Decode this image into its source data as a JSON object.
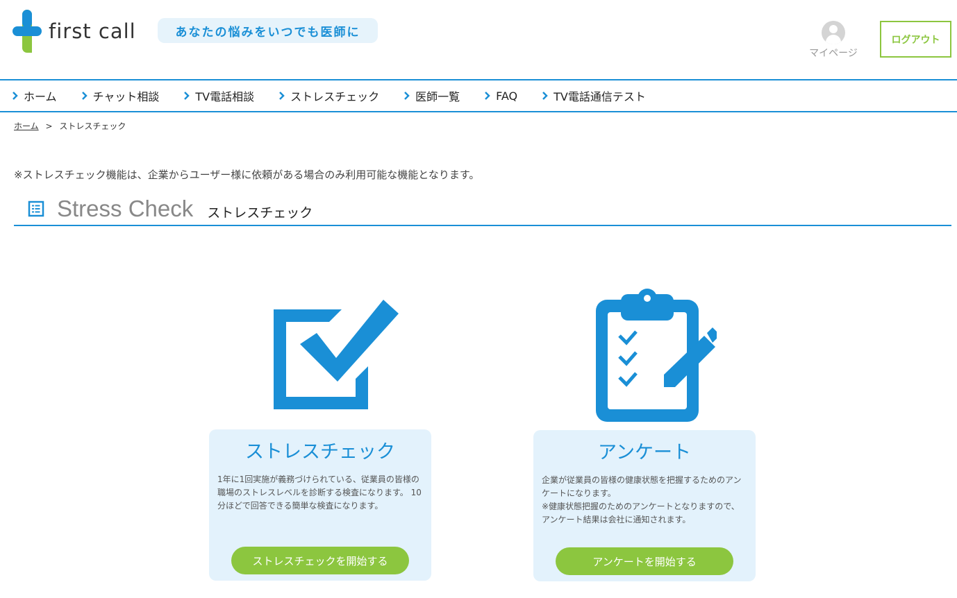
{
  "header": {
    "logo_text": "first call",
    "tagline": "あなたの悩みをいつでも医師に",
    "mypage_label": "マイページ",
    "logout_label": "ログアウト"
  },
  "nav": {
    "items": [
      {
        "label": "ホーム"
      },
      {
        "label": "チャット相談"
      },
      {
        "label": "TV電話相談"
      },
      {
        "label": "ストレスチェック"
      },
      {
        "label": "医師一覧"
      },
      {
        "label": "FAQ"
      },
      {
        "label": "TV電話通信テスト"
      }
    ]
  },
  "breadcrumb": {
    "home": "ホーム",
    "separator": ">",
    "current": "ストレスチェック"
  },
  "notice": "※ストレスチェック機能は、企業からユーザー様に依頼がある場合のみ利用可能な機能となります。",
  "section": {
    "title_en": "Stress Check",
    "title_jp": "ストレスチェック"
  },
  "cards": [
    {
      "icon": "checkbox-icon",
      "title": "ストレスチェック",
      "desc_lines": [
        "1年に1回実施が義務づけられている、従業員の皆様の",
        "職場のストレスレベルを診断する検査になります。 10",
        "分ほどで回答できる簡単な検査になります。"
      ],
      "button": "ストレスチェックを開始する"
    },
    {
      "icon": "clipboard-icon",
      "title": "アンケート",
      "desc_lines": [
        "企業が従業員の皆様の健康状態を把握するためのアン",
        "ケートになります。",
        "※健康状態把握のためのアンケートとなりますので、",
        "アンケート結果は会社に通知されます。"
      ],
      "button": "アンケートを開始する"
    }
  ],
  "colors": {
    "brand_blue": "#1a8fd6",
    "brand_green": "#8cc63f",
    "card_bg": "#e3f2fc"
  }
}
